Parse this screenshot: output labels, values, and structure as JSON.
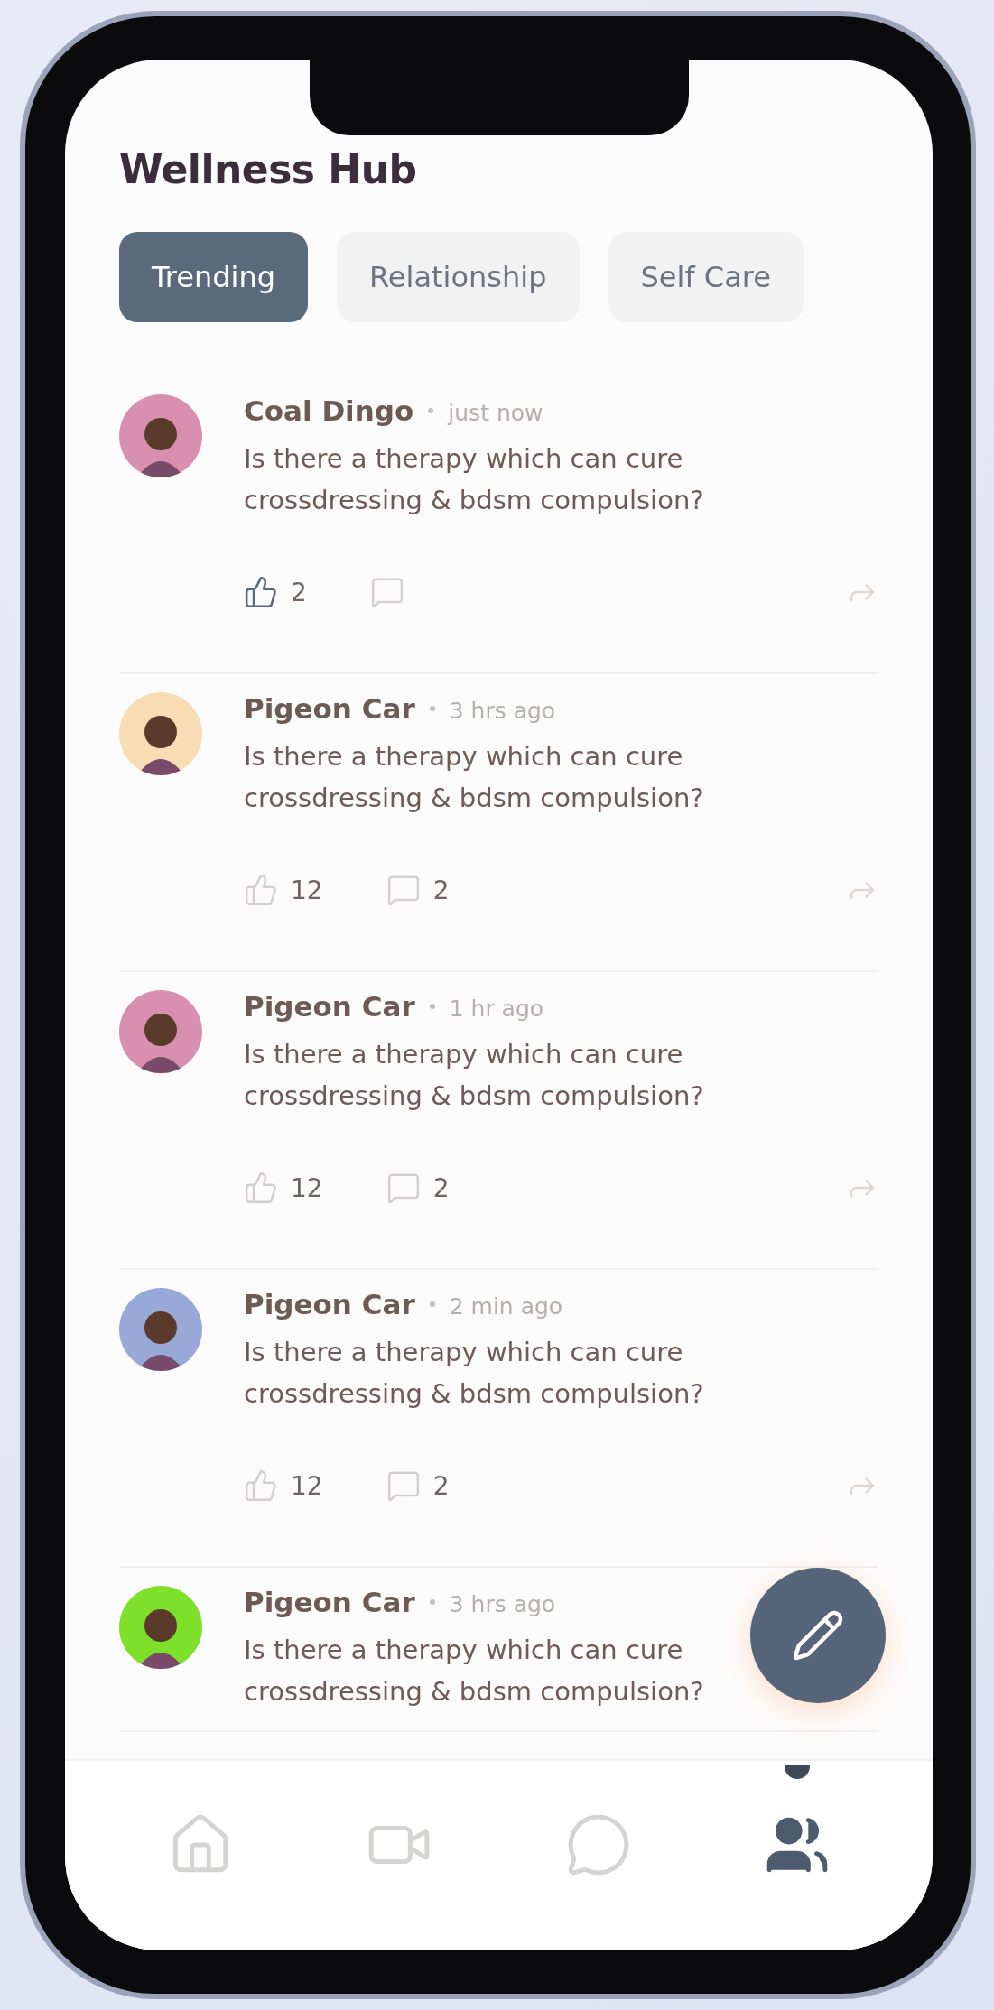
{
  "app": {
    "title": "Wellness Hub"
  },
  "tabs": [
    {
      "label": "Trending",
      "selected": true
    },
    {
      "label": "Relationship",
      "selected": false
    },
    {
      "label": "Self Care",
      "selected": false
    }
  ],
  "posts": [
    {
      "author": "Coal Dingo",
      "time": "just now",
      "text": "Is there a therapy which can cure crossdressing & bdsm compulsion?",
      "color": "#d98fae",
      "likes": "2",
      "liked": true
    },
    {
      "author": "Pigeon Car",
      "time": "3 hrs ago",
      "text": "Is there a therapy which can cure crossdressing & bdsm compulsion?",
      "color": "#f7dcb4",
      "likes": "12",
      "comments": "2",
      "liked": false
    },
    {
      "author": "Pigeon Car",
      "time": "1 hr ago",
      "text": "Is there a therapy which can cure crossdressing & bdsm compulsion?",
      "color": "#d98fae",
      "likes": "12",
      "comments": "2",
      "liked": false
    },
    {
      "author": "Pigeon Car",
      "time": "2 min ago",
      "text": "Is there a therapy which can cure crossdressing & bdsm compulsion?",
      "color": "#98a8d8",
      "likes": "12",
      "comments": "2",
      "liked": false
    },
    {
      "author": "Pigeon Car",
      "time": "3 hrs ago",
      "text": "Is there a therapy which can cure crossdressing & bdsm compulsion?",
      "color": "#7ee02a"
    }
  ],
  "bottom_nav": [
    {
      "kind": "home",
      "selected": false
    },
    {
      "kind": "video",
      "selected": false
    },
    {
      "kind": "chat",
      "selected": false
    },
    {
      "kind": "community",
      "selected": true
    }
  ]
}
